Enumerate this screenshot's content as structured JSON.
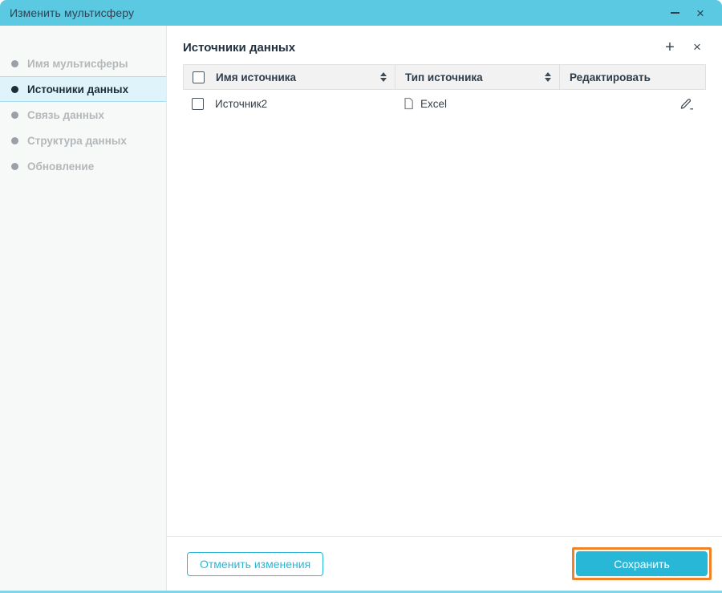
{
  "window": {
    "title": "Изменить мультисферу"
  },
  "sidebar": {
    "items": [
      {
        "label": "Имя мультисферы",
        "active": false
      },
      {
        "label": "Источники данных",
        "active": true
      },
      {
        "label": "Связь данных",
        "active": false
      },
      {
        "label": "Структура данных",
        "active": false
      },
      {
        "label": "Обновление",
        "active": false
      }
    ]
  },
  "content": {
    "title": "Источники данных",
    "add_icon": "+",
    "close_icon": "×",
    "table": {
      "columns": [
        "Имя источника",
        "Тип источника",
        "Редактировать"
      ],
      "rows": [
        {
          "name": "Источник2",
          "type": "Excel",
          "type_icon": "document-icon",
          "checked": false
        }
      ]
    }
  },
  "footer": {
    "cancel_label": "Отменить изменения",
    "save_label": "Сохранить"
  },
  "colors": {
    "titlebar": "#5bc9e2",
    "accent": "#29b7d8",
    "highlight_box": "#f08229",
    "active_item_bg": "#def3fa",
    "table_header_bg": "#f2f2f2"
  }
}
